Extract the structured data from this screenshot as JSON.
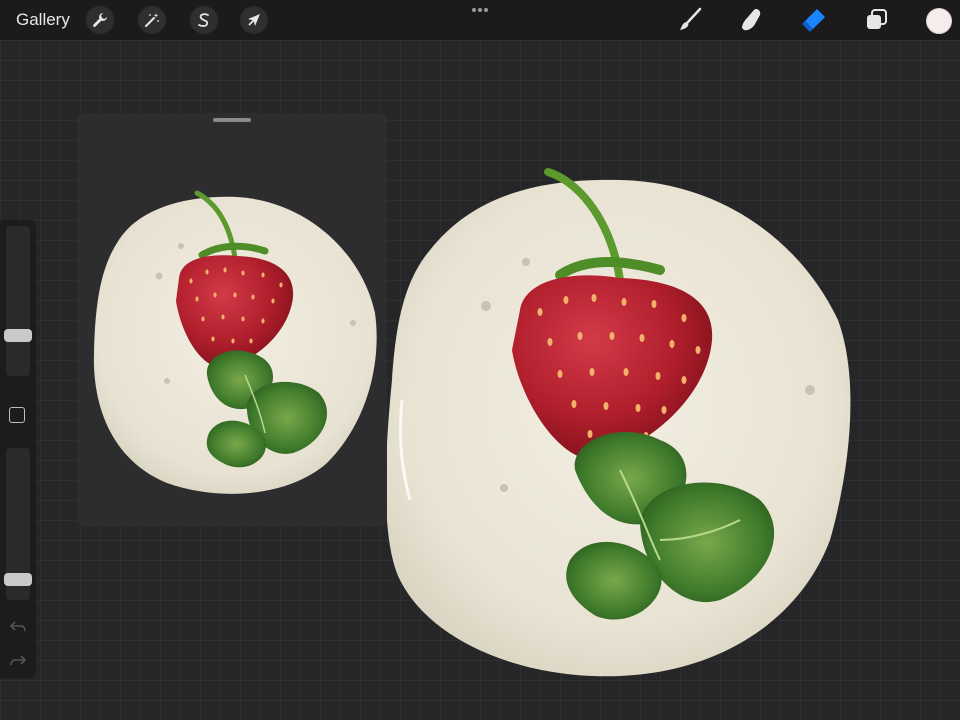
{
  "topbar": {
    "gallery_label": "Gallery",
    "tools_left": [
      {
        "name": "actions",
        "icon": "wrench-icon"
      },
      {
        "name": "adjustments",
        "icon": "magic-wand-icon"
      },
      {
        "name": "selection",
        "icon": "selection-s-icon"
      },
      {
        "name": "transform",
        "icon": "arrow-cursor-icon"
      }
    ],
    "more_icon": "more-dots-icon",
    "tools_right": [
      {
        "name": "brush",
        "icon": "brush-icon"
      },
      {
        "name": "smudge",
        "icon": "smudge-finger-icon"
      },
      {
        "name": "eraser",
        "icon": "eraser-icon",
        "active": true
      },
      {
        "name": "layers",
        "icon": "layers-icon"
      }
    ],
    "current_color": "#f7ecec"
  },
  "sidebar": {
    "brush_size_level": 0.25,
    "opacity_level": 0.1
  },
  "reference_window": {
    "visible": true
  },
  "colors": {
    "canvas_bg": "#262628",
    "toolbar_bg": "#1b1b1c",
    "accent_active": "#1a84ff",
    "cream": "#eae5d6",
    "strawberry": "#b8202e",
    "leaf": "#3f7a2c"
  }
}
